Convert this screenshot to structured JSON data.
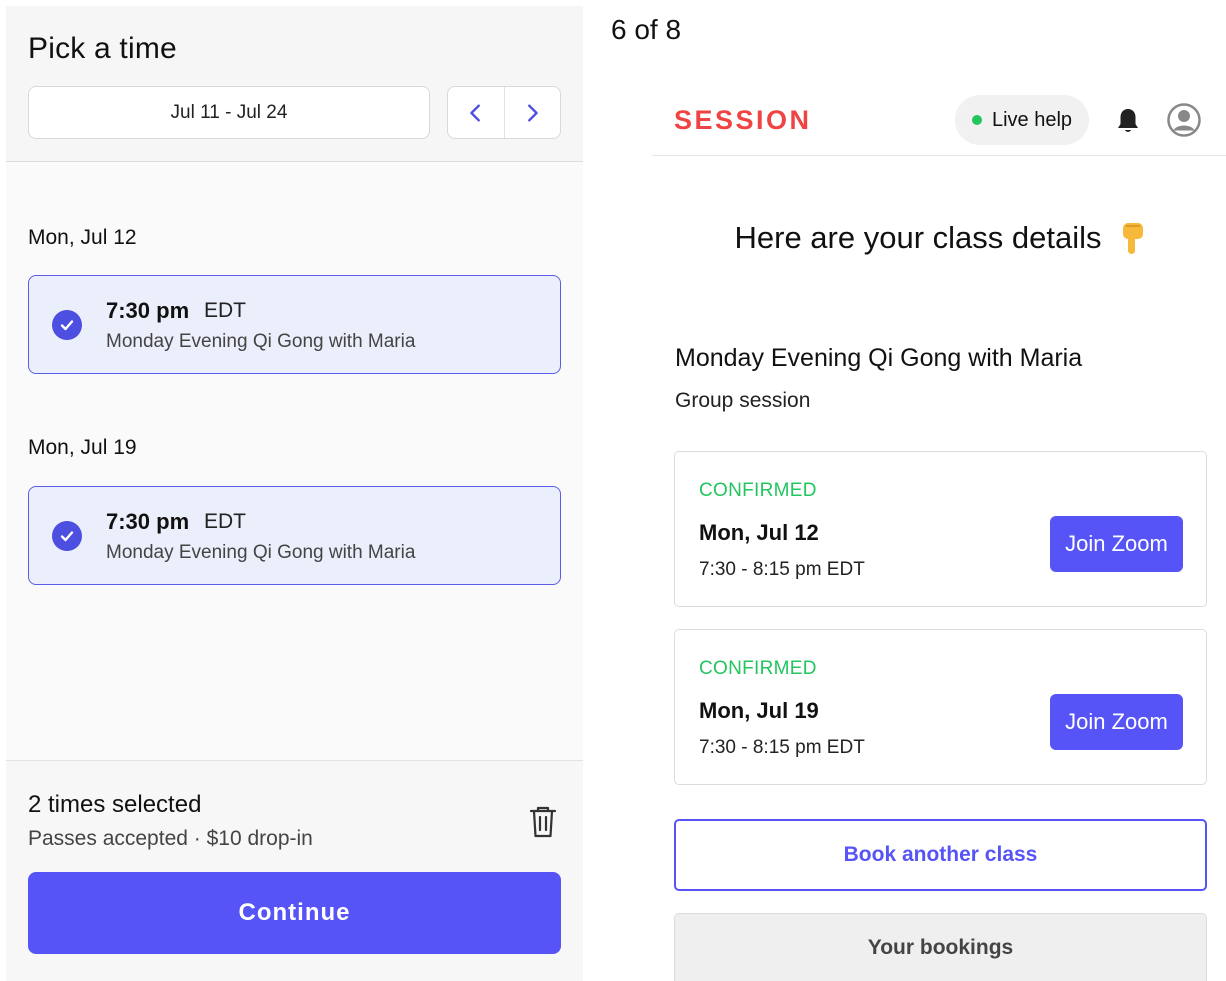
{
  "left_panel": {
    "title": "Pick a time",
    "date_range": "Jul 11 - Jul 24",
    "days": [
      {
        "label": "Mon, Jul 12",
        "slot": {
          "time": "7:30 pm",
          "tz": "EDT",
          "title": "Monday Evening Qi Gong with Maria",
          "selected": true
        }
      },
      {
        "label": "Mon, Jul 19",
        "slot": {
          "time": "7:30 pm",
          "tz": "EDT",
          "title": "Monday Evening Qi Gong with Maria",
          "selected": true
        }
      }
    ],
    "footer": {
      "selected_count": "2 times selected",
      "subtitle": "Passes accepted · $10 drop-in",
      "continue_label": "Continue"
    }
  },
  "page_counter": "6 of 8",
  "right_panel": {
    "brand": "SESSION",
    "live_help_label": "Live help",
    "heading": "Here are your class details",
    "class_name": "Monday Evening Qi Gong with Maria",
    "class_type": "Group session",
    "bookings": [
      {
        "status": "CONFIRMED",
        "date": "Mon, Jul 12",
        "time": "7:30 - 8:15 pm EDT",
        "action": "Join Zoom"
      },
      {
        "status": "CONFIRMED",
        "date": "Mon, Jul 19",
        "time": "7:30 - 8:15 pm EDT",
        "action": "Join Zoom"
      }
    ],
    "book_another_label": "Book another class",
    "your_bookings_label": "Your bookings"
  },
  "colors": {
    "accent": "#5654f6",
    "brand_red": "#ef4444",
    "confirmed_green": "#22c55e",
    "selected_slot_bg": "#ebeffb"
  },
  "icons": [
    "chevron-left-icon",
    "chevron-right-icon",
    "checkmark-icon",
    "trash-icon",
    "bell-icon",
    "user-avatar-icon",
    "pointing-down-hand-icon"
  ]
}
